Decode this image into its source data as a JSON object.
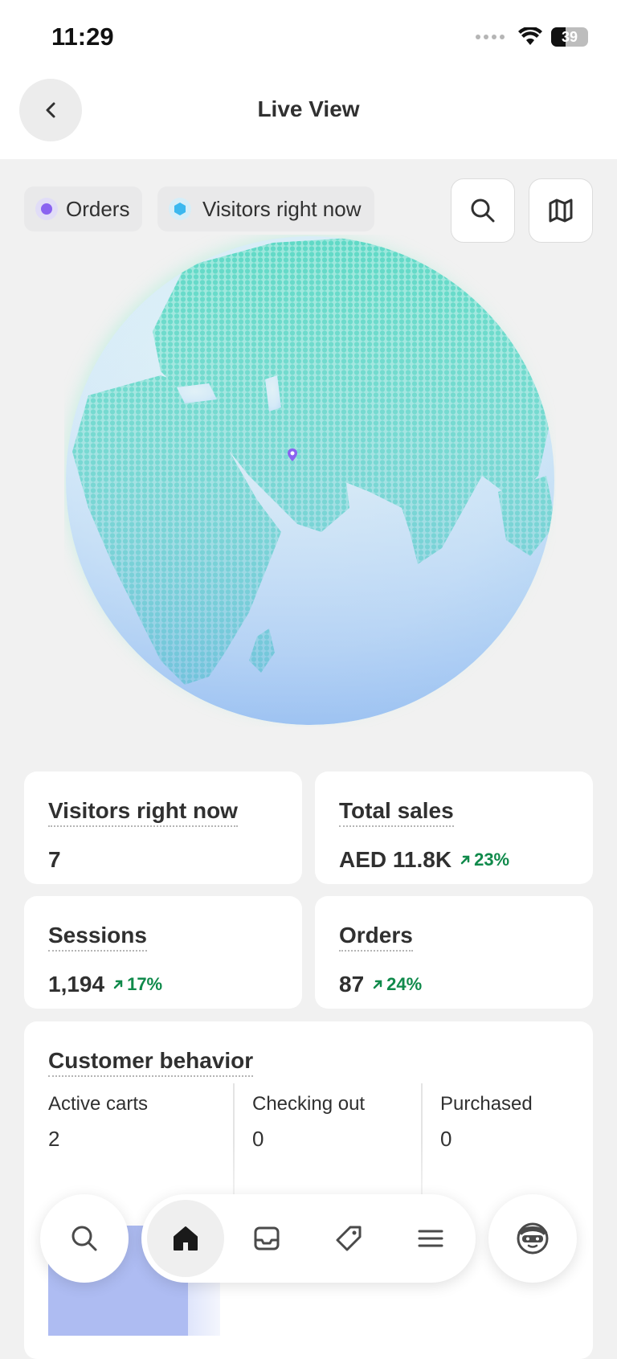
{
  "status_bar": {
    "time": "11:29",
    "battery": "39",
    "battery_level": 0.39
  },
  "header": {
    "title": "Live View"
  },
  "legend": [
    {
      "label": "Orders",
      "color": "#8a63f0"
    },
    {
      "label": "Visitors right now",
      "color": "#3bb8ef"
    }
  ],
  "map_controls": {
    "search_icon": "search-icon",
    "map_icon": "map-icon"
  },
  "globe": {
    "colors": {
      "land": "#5fd9c6",
      "ocean": "#d9eef7",
      "pin": "#8a63f0"
    }
  },
  "metrics": {
    "visitors": {
      "label": "Visitors right now",
      "value": "7"
    },
    "sales": {
      "label": "Total sales",
      "value": "AED 11.8K",
      "delta": "23%"
    },
    "sessions": {
      "label": "Sessions",
      "value": "1,194",
      "delta": "17%"
    },
    "orders": {
      "label": "Orders",
      "value": "87",
      "delta": "24%"
    }
  },
  "customer_behavior": {
    "title": "Customer behavior",
    "columns": [
      {
        "label": "Active carts",
        "value": "2"
      },
      {
        "label": "Checking out",
        "value": "0"
      },
      {
        "label": "Purchased",
        "value": "0"
      }
    ]
  },
  "nav": {
    "items": [
      "search-icon",
      "home-icon",
      "inbox-icon",
      "tag-icon",
      "menu-icon",
      "avatar-icon"
    ],
    "active": "home"
  },
  "colors": {
    "positive": "#108a4b",
    "accent": "#8a63f0"
  }
}
